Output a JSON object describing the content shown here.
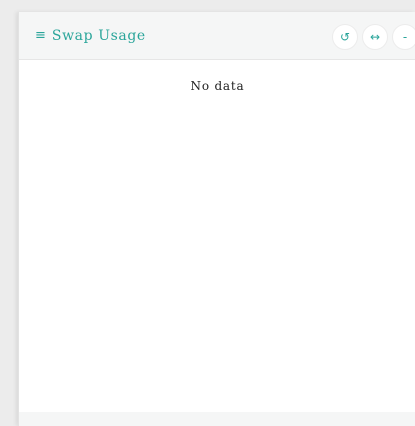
{
  "panel": {
    "menu_icon": "≡",
    "title": "Swap Usage",
    "controls": {
      "refresh_icon": "↺",
      "expand_icon": "↔",
      "minimize_icon": "-"
    },
    "empty_message": "No data"
  },
  "colors": {
    "accent": "#2aa59a",
    "header_bg": "#f5f6f6",
    "body_bg": "#ffffff"
  }
}
